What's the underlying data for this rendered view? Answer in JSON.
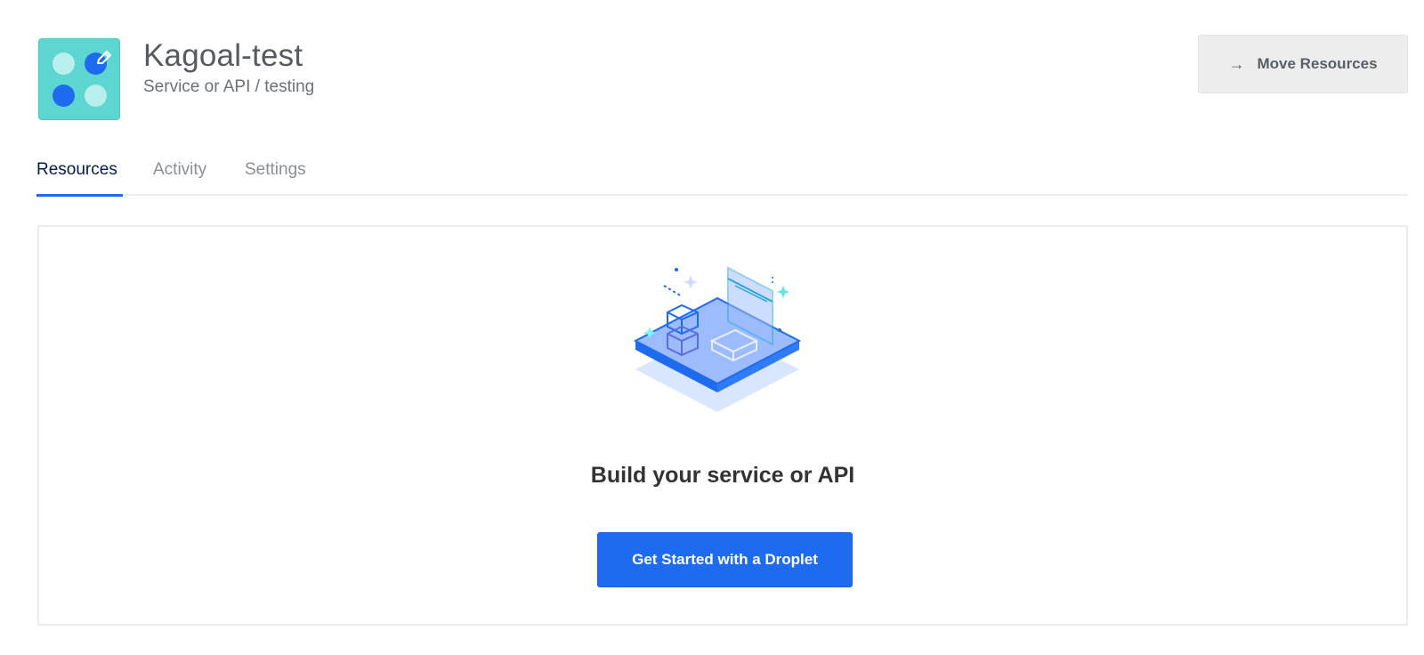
{
  "project": {
    "name": "Kagoal-test",
    "subtitle": "Service or API / testing",
    "icon": "project-dots-icon",
    "edit_icon": "pencil-icon"
  },
  "header": {
    "move_button_label": "Move Resources",
    "move_button_icon": "arrow-right-icon"
  },
  "tabs": [
    {
      "label": "Resources",
      "active": true
    },
    {
      "label": "Activity",
      "active": false
    },
    {
      "label": "Settings",
      "active": false
    }
  ],
  "empty_state": {
    "illustration": "isometric-platform-illustration",
    "title": "Build your service or API",
    "cta_label": "Get Started with a Droplet"
  },
  "colors": {
    "accent": "#1f6bf0",
    "icon_bg": "#5dd6d1",
    "tab_active": "#031b4e"
  }
}
